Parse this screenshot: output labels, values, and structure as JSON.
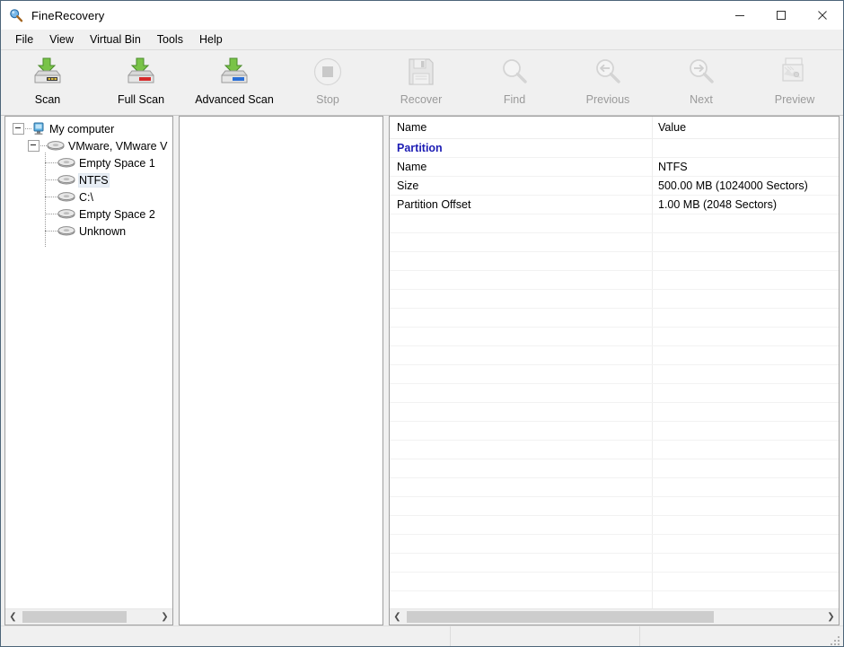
{
  "window": {
    "title": "FineRecovery",
    "title_icon": "magnifier-icon",
    "controls": {
      "minimize": "minimize-icon",
      "maximize": "maximize-icon",
      "close": "close-icon"
    }
  },
  "menubar": {
    "items": [
      {
        "label": "File"
      },
      {
        "label": "View"
      },
      {
        "label": "Virtual Bin"
      },
      {
        "label": "Tools"
      },
      {
        "label": "Help"
      }
    ]
  },
  "toolbar": {
    "buttons": [
      {
        "label": "Scan",
        "icon": "drive-download-icon",
        "enabled": true
      },
      {
        "label": "Full Scan",
        "icon": "drive-download-red-icon",
        "enabled": true
      },
      {
        "label": "Advanced Scan",
        "icon": "drive-download-blue-icon",
        "enabled": true
      },
      {
        "label": "Stop",
        "icon": "stop-circle-icon",
        "enabled": false
      },
      {
        "label": "Recover",
        "icon": "floppy-save-icon",
        "enabled": false
      },
      {
        "label": "Find",
        "icon": "magnifier-icon",
        "enabled": false
      },
      {
        "label": "Previous",
        "icon": "magnifier-left-arrow-icon",
        "enabled": false
      },
      {
        "label": "Next",
        "icon": "magnifier-right-arrow-icon",
        "enabled": false
      },
      {
        "label": "Preview",
        "icon": "image-preview-icon",
        "enabled": false
      }
    ]
  },
  "tree": {
    "nodes": [
      {
        "label": "My computer",
        "icon": "computer-icon",
        "depth": 0,
        "expander": "collapse",
        "selected": false
      },
      {
        "label": "VMware,  VMware V",
        "icon": "disk-icon",
        "depth": 1,
        "expander": "collapse",
        "selected": false
      },
      {
        "label": "Empty Space 1",
        "icon": "disk-icon",
        "depth": 2,
        "expander": "none",
        "selected": false
      },
      {
        "label": "NTFS",
        "icon": "disk-icon",
        "depth": 2,
        "expander": "none",
        "selected": true
      },
      {
        "label": "C:\\",
        "icon": "disk-icon",
        "depth": 2,
        "expander": "none",
        "selected": false
      },
      {
        "label": "Empty Space 2",
        "icon": "disk-icon",
        "depth": 2,
        "expander": "none",
        "selected": false
      },
      {
        "label": "Unknown",
        "icon": "disk-icon",
        "depth": 2,
        "expander": "none",
        "selected": false
      }
    ],
    "scrollbar": {
      "left_arrow": "chevron-left-icon",
      "right_arrow": "chevron-right-icon"
    }
  },
  "middle_pane": {
    "content": ""
  },
  "details": {
    "columns": [
      {
        "label": "Name"
      },
      {
        "label": "Value"
      }
    ],
    "rows": [
      {
        "name": "Partition",
        "value": "",
        "group": true
      },
      {
        "name": "Name",
        "value": "NTFS",
        "group": false
      },
      {
        "name": "Size",
        "value": "500.00 MB (1024000 Sectors)",
        "group": false
      },
      {
        "name": "Partition Offset",
        "value": "1.00 MB (2048 Sectors)",
        "group": false
      }
    ],
    "scrollbar": {
      "left_arrow": "chevron-left-icon",
      "right_arrow": "chevron-right-icon"
    }
  },
  "statusbar": {
    "cells": [
      "",
      "",
      ""
    ],
    "grip": "resize-grip-icon"
  },
  "colors": {
    "group_header": "#1d1db4",
    "window_bg": "#f0f0f0",
    "pane_bg": "#ffffff",
    "selection": "#e8eef5",
    "window_border": "#4d6579"
  }
}
